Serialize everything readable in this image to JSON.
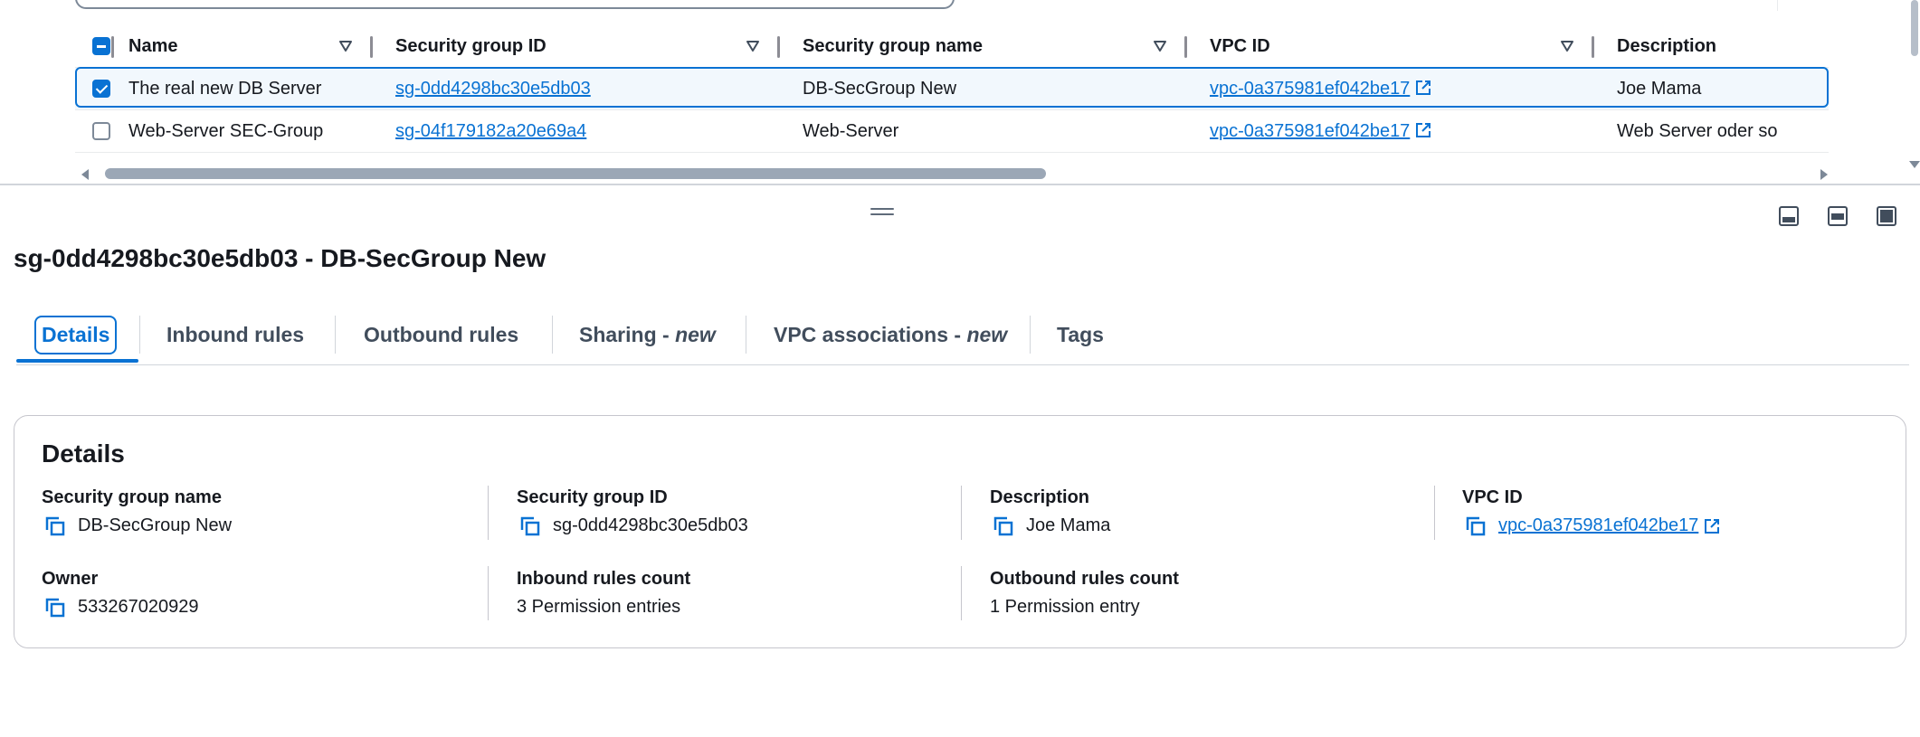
{
  "table": {
    "columns": [
      {
        "label": "Name"
      },
      {
        "label": "Security group ID"
      },
      {
        "label": "Security group name"
      },
      {
        "label": "VPC ID"
      },
      {
        "label": "Description"
      }
    ],
    "rows": [
      {
        "selected": true,
        "name": "The real new DB Server",
        "sg_id": "sg-0dd4298bc30e5db03",
        "sg_name": "DB-SecGroup New",
        "vpc_id": "vpc-0a375981ef042be17",
        "description": "Joe Mama"
      },
      {
        "selected": false,
        "name": "Web-Server SEC-Group",
        "sg_id": "sg-04f179182a20e69a4",
        "sg_name": "Web-Server",
        "vpc_id": "vpc-0a375981ef042be17",
        "description": "Web Server oder so"
      }
    ]
  },
  "panel": {
    "title": "sg-0dd4298bc30e5db03 - DB-SecGroup New",
    "tabs": [
      {
        "label": "Details",
        "suffix": "",
        "active": true
      },
      {
        "label": "Inbound rules",
        "suffix": ""
      },
      {
        "label": "Outbound rules",
        "suffix": ""
      },
      {
        "label": "Sharing - ",
        "suffix": "new"
      },
      {
        "label": "VPC associations - ",
        "suffix": "new"
      },
      {
        "label": "Tags",
        "suffix": ""
      }
    ]
  },
  "details": {
    "heading": "Details",
    "sg_name_label": "Security group name",
    "sg_name_value": "DB-SecGroup New",
    "sg_id_label": "Security group ID",
    "sg_id_value": "sg-0dd4298bc30e5db03",
    "description_label": "Description",
    "description_value": "Joe Mama",
    "vpc_label": "VPC ID",
    "vpc_value": "vpc-0a375981ef042be17",
    "owner_label": "Owner",
    "owner_value": "533267020929",
    "inbound_label": "Inbound rules count",
    "inbound_value": "3 Permission entries",
    "outbound_label": "Outbound rules count",
    "outbound_value": "1 Permission entry"
  },
  "icons": {
    "copy": "copy-icon",
    "external": "external-link-icon",
    "sort": "sort-caret-icon"
  },
  "colors": {
    "link": "#0972d3",
    "accent": "#0972d3",
    "selected_row_bg": "#f2f8fd",
    "text": "#16191f"
  }
}
